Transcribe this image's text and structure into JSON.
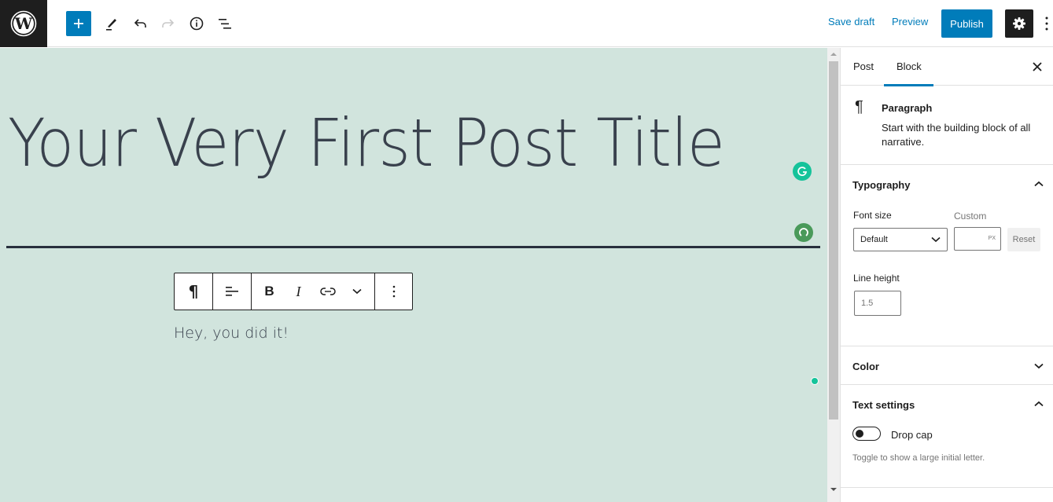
{
  "topbar": {
    "logo": "wordpress-logo",
    "tools": [
      {
        "name": "add-block",
        "icon": "plus-icon"
      },
      {
        "name": "tools",
        "icon": "pencil-icon"
      },
      {
        "name": "undo",
        "icon": "undo-icon"
      },
      {
        "name": "redo",
        "icon": "redo-icon"
      },
      {
        "name": "details",
        "icon": "info-icon"
      },
      {
        "name": "list-view",
        "icon": "list-view-icon"
      }
    ],
    "save_draft_label": "Save draft",
    "preview_label": "Preview",
    "publish_label": "Publish",
    "colors": {
      "accent": "#007cba",
      "dark": "#1e1e1e"
    }
  },
  "editor": {
    "background": "#d1e4dd",
    "post_title": "Your Very First Post Title",
    "block_toolbar": {
      "buttons": [
        "paragraph-block-type",
        "align",
        "bold",
        "italic",
        "link",
        "more-rich-text",
        "options"
      ]
    },
    "paragraph_text": "Hey, you did it!"
  },
  "sidebar": {
    "tabs": [
      {
        "label": "Post",
        "active": false
      },
      {
        "label": "Block",
        "active": true
      }
    ],
    "block_card": {
      "name": "Paragraph",
      "description": "Start with the building block of all narrative."
    },
    "typography": {
      "title": "Typography",
      "expanded": true,
      "font_size_label": "Font size",
      "font_size_value": "Default",
      "custom_label": "Custom",
      "custom_value": "",
      "custom_unit": "PX",
      "reset_label": "Reset",
      "line_height_label": "Line height",
      "line_height_placeholder": "1.5"
    },
    "color": {
      "title": "Color",
      "expanded": false
    },
    "text_settings": {
      "title": "Text settings",
      "expanded": true,
      "drop_cap_label": "Drop cap",
      "drop_cap_enabled": false,
      "help": "Toggle to show a large initial letter."
    }
  }
}
